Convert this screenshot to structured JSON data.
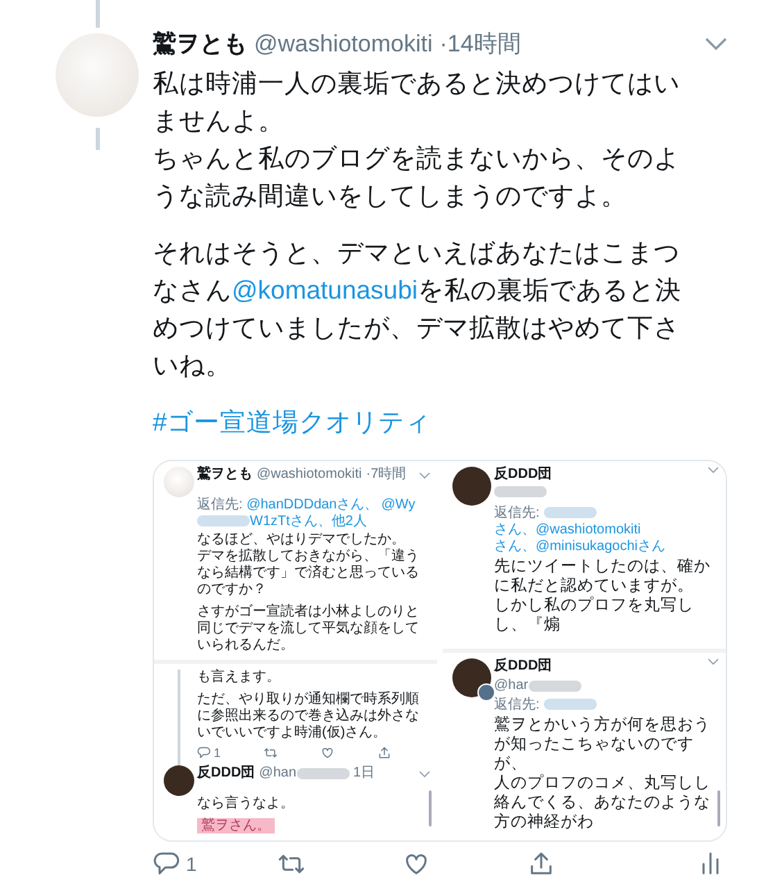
{
  "tweet": {
    "author": {
      "name": "鷲ヲとも",
      "handle": "@washiotomokiti",
      "time": "·14時間"
    },
    "paragraphs": [
      {
        "lines": [
          [
            {
              "kind": "text",
              "text": "私は時浦一人の裏垢であると決めつけてはいませんよ。"
            }
          ],
          [
            {
              "kind": "text",
              "text": "ちゃんと私のブログを読まないから、そのような読み間違いをしてしまうのですよ。"
            }
          ]
        ]
      },
      {
        "lines": [
          [
            {
              "kind": "text",
              "text": "それはそうと、デマといえばあなたはこまつなさん"
            },
            {
              "kind": "mention",
              "text": "@komatunasubi"
            },
            {
              "kind": "text",
              "text": "を私の裏垢であると決めつけていましたが、デマ拡散はやめて下さいね。"
            }
          ]
        ]
      },
      {
        "lines": [
          [
            {
              "kind": "hashtag",
              "text": "#ゴー宣道場クオリティ"
            }
          ]
        ]
      }
    ],
    "media": {
      "columns": [
        [
          {
            "thread_line": false,
            "scrollbar": false,
            "blocks": [
              {
                "kind": "header",
                "avatar": {
                  "kind": "painted"
                },
                "name": "鷲ヲとも",
                "handle": "@washiotomokiti",
                "time": "·7時間",
                "blurred": false,
                "badge": false
              },
              {
                "kind": "reply",
                "label": "返信先:",
                "parts": [
                  {
                    "kind": "link",
                    "text": "@hanDDDdanさん、"
                  },
                  {
                    "kind": "link",
                    "text": "@Wy"
                  },
                  {
                    "kind": "blur"
                  },
                  {
                    "kind": "link",
                    "text": "W1zTtさん、他2人"
                  }
                ]
              },
              {
                "kind": "text",
                "text": "なるほど、やはりデマでしたか。",
                "highlighted": false
              },
              {
                "kind": "text",
                "text": "デマを拡散しておきながら、「違うなら結構です」で済むと思っているのですか？",
                "highlighted": false
              },
              {
                "kind": "gap"
              },
              {
                "kind": "text",
                "text": "さすがゴー宣読者は小林よしのりと同じでデマを流して平気な顔をしていられるんだ。",
                "highlighted": false
              }
            ]
          },
          {
            "thread_line": true,
            "scrollbar": true,
            "blocks": [
              {
                "kind": "text",
                "text": "も言えます。",
                "highlighted": false
              },
              {
                "kind": "gap"
              },
              {
                "kind": "text",
                "text": "ただ、やり取りが通知欄で時系列順に参照出来るので巻き込みは外さないでいいですよ時浦(仮)さん。",
                "highlighted": false
              },
              {
                "kind": "actions",
                "items": [
                  {
                    "kind": "reply",
                    "count": "1"
                  },
                  {
                    "kind": "retweet"
                  },
                  {
                    "kind": "like"
                  },
                  {
                    "kind": "share"
                  }
                ]
              },
              {
                "kind": "header",
                "avatar": {
                  "kind": "owl"
                },
                "name": "反DDD団",
                "handle": "@han",
                "time": "1日",
                "blurred": true,
                "badge": false
              },
              {
                "kind": "text",
                "text": "なら言うなよ。",
                "highlighted": false
              },
              {
                "kind": "gap"
              },
              {
                "kind": "text",
                "text": "鷲ヲさん。",
                "highlighted": true
              }
            ]
          }
        ],
        [
          {
            "thread_line": false,
            "scrollbar": false,
            "blocks": [
              {
                "kind": "header",
                "avatar": {
                  "kind": "owl"
                },
                "name": "反DDD団",
                "blurred": true,
                "badge": false
              },
              {
                "kind": "reply",
                "label": "返信先:",
                "parts": [
                  {
                    "kind": "blur"
                  },
                  {
                    "kind": "link",
                    "text": "さん、@washiotomokiti"
                  },
                  {
                    "kind": "link",
                    "text": "さん、@minisukagochiさん"
                  }
                ]
              },
              {
                "kind": "text",
                "text": "先にツイートしたのは、確かに私だと認めていますが。",
                "highlighted": false
              },
              {
                "kind": "text",
                "text": "しかし私のプロフを丸写しし、『煽",
                "highlighted": false
              }
            ]
          },
          {
            "thread_line": false,
            "scrollbar": true,
            "blocks": [
              {
                "kind": "header",
                "avatar": {
                  "kind": "owl"
                },
                "name": "反DDD団",
                "handle": "@har",
                "blurred": true,
                "badge": true
              },
              {
                "kind": "reply",
                "label": "返信先:",
                "parts": [
                  {
                    "kind": "blur"
                  }
                ]
              },
              {
                "kind": "text",
                "text": "鷲ヲとかいう方が何を思おうが知ったこちゃないのですが、",
                "highlighted": false
              },
              {
                "kind": "text",
                "text": "人のプロフのコメ、丸写しし絡んでくる、あなたのような方の神経がわ",
                "highlighted": false
              }
            ]
          }
        ]
      ]
    },
    "actions": [
      {
        "kind": "reply",
        "count": "1"
      },
      {
        "kind": "retweet"
      },
      {
        "kind": "like"
      },
      {
        "kind": "share"
      },
      {
        "kind": "analytics"
      }
    ]
  }
}
